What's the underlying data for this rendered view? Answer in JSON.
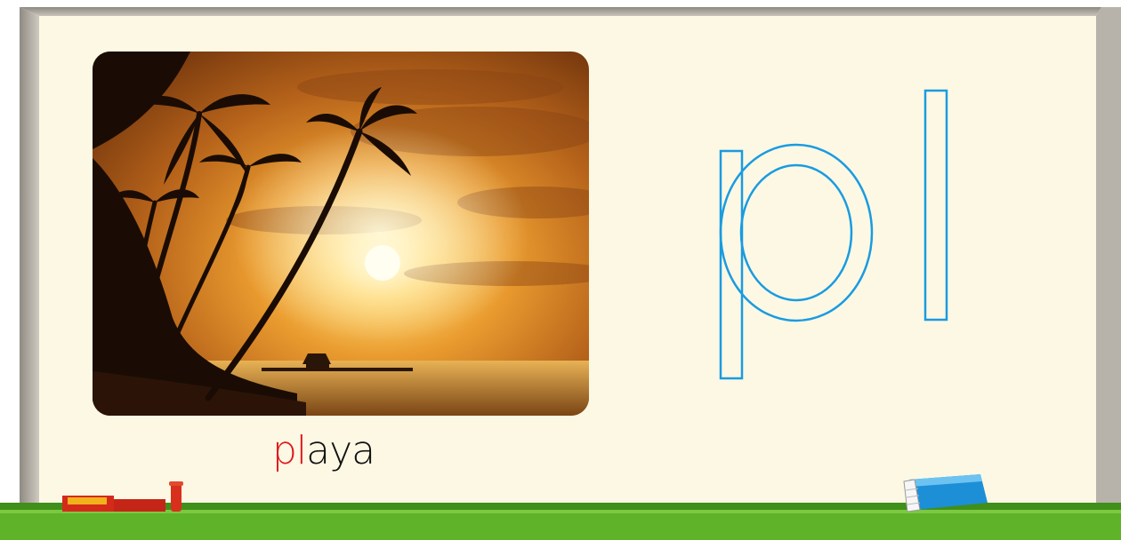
{
  "word": {
    "highlight": "pl",
    "rest": "aya"
  },
  "big_letters": "pl",
  "colors": {
    "board": "#fcf8e4",
    "frame": "#a39e96",
    "tray": "#5fb329",
    "highlight": "#e0161c",
    "outline_letters": "#1a9be0"
  },
  "icons": [
    "chalk-holder-icon",
    "eraser-icon"
  ]
}
